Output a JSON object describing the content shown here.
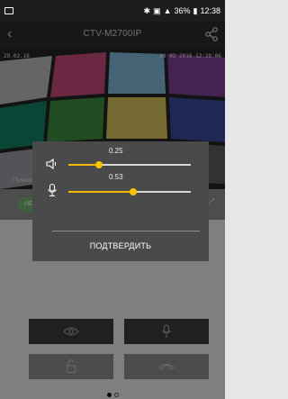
{
  "status_bar": {
    "battery": "36%",
    "time": "12:38"
  },
  "header": {
    "title": "CTV-M2700IP"
  },
  "video": {
    "osd_left": "29.02.16",
    "osd_right": "29 02 2016 12:38:06",
    "live_label": "Прямая трансляция"
  },
  "toolbar": {
    "left_pill": "HD"
  },
  "dialog": {
    "speaker_value": 0.25,
    "speaker_label": "0.25",
    "mic_value": 0.53,
    "mic_label": "0.53",
    "confirm_label": "ПОДТВЕРДИТЬ"
  },
  "colors": {
    "slider_accent": "#f5c400",
    "pill_green": "#6fb26f",
    "button_dark": "#3b3b3b"
  },
  "icons": {
    "speaker": "speaker-icon",
    "microphone": "microphone-icon",
    "eye": "eye-icon",
    "lock": "lock-icon",
    "hangup": "hangup-icon",
    "share": "share-icon",
    "back": "back-arrow-icon"
  },
  "pager": {
    "pages": 2,
    "current": 1
  }
}
